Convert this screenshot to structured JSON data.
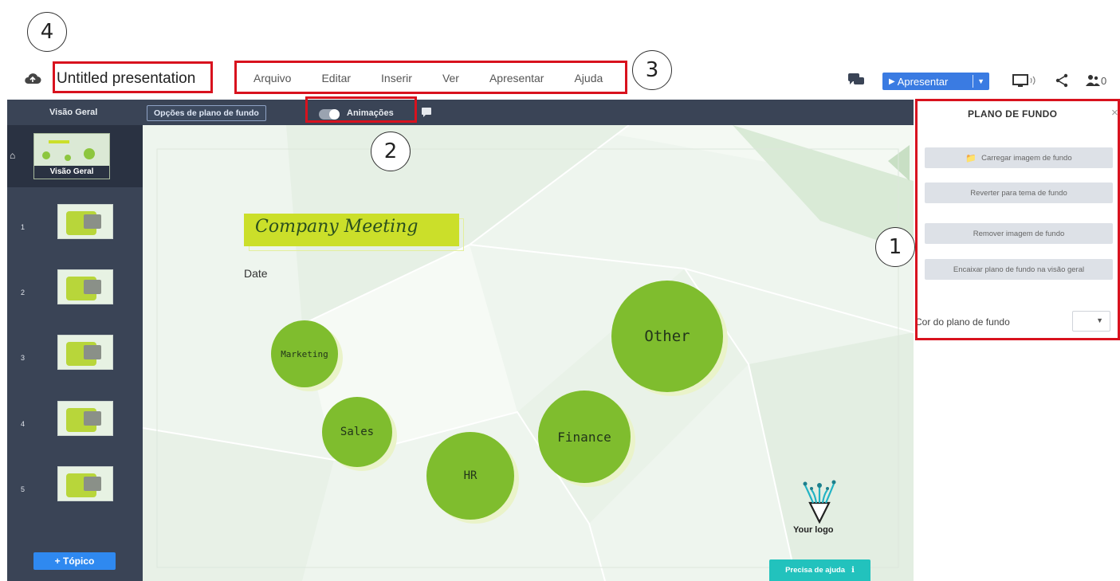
{
  "app": {
    "title": "Untitled presentation",
    "menu": [
      "Arquivo",
      "Editar",
      "Inserir",
      "Ver",
      "Apresentar",
      "Ajuda"
    ],
    "present_label": "Apresentar",
    "collab_count": "0"
  },
  "toolbar": {
    "overview_tab": "Visão Geral",
    "bg_options": "Opções de plano de fundo",
    "animations": "Animações"
  },
  "sidebar": {
    "overview_caption": "Visão Geral",
    "slides": [
      "1",
      "2",
      "3",
      "4",
      "5"
    ],
    "topic_button": "+ Tópico"
  },
  "slide": {
    "title": "Company Meeting",
    "date": "Date",
    "bubbles": [
      "Marketing",
      "Sales",
      "HR",
      "Finance",
      "Other"
    ],
    "logo_text": "Your logo",
    "accent": "#7fbd2e",
    "title_bg": "#cbdf2a"
  },
  "help": {
    "label": "Precisa de ajuda"
  },
  "panel": {
    "title": "PLANO DE FUNDO",
    "close": "×",
    "buttons": [
      "Carregar imagem de fundo",
      "Reverter para tema de fundo",
      "Remover imagem de fundo",
      "Encaixar plano de fundo na visão geral"
    ],
    "bg_color_label": "Cor do plano de fundo"
  },
  "annotations": [
    "1",
    "2",
    "3",
    "4"
  ]
}
